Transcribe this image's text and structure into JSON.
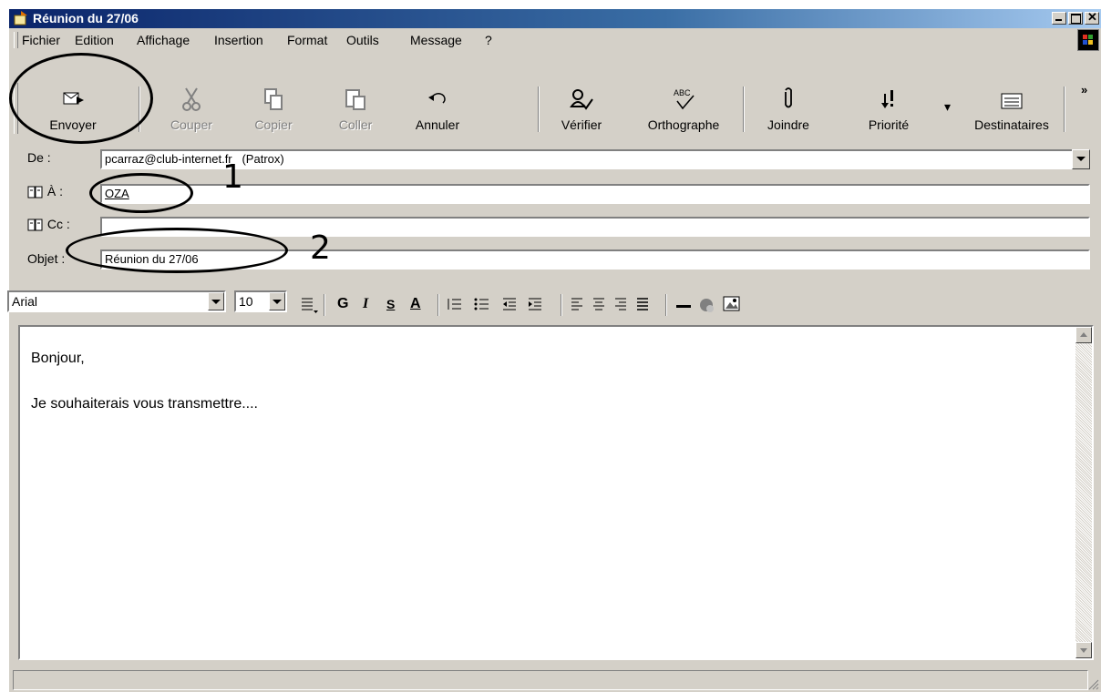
{
  "window": {
    "title": "Réunion du 27/06"
  },
  "menu": {
    "items": [
      "Fichier",
      "Edition",
      "Affichage",
      "Insertion",
      "Format",
      "Outils",
      "Message",
      "?"
    ]
  },
  "toolbar": {
    "buttons": [
      {
        "label": "Envoyer",
        "icon": "send-icon",
        "enabled": true
      },
      {
        "label": "Couper",
        "icon": "scissors-icon",
        "enabled": false
      },
      {
        "label": "Copier",
        "icon": "copy-icon",
        "enabled": false
      },
      {
        "label": "Coller",
        "icon": "paste-icon",
        "enabled": false
      },
      {
        "label": "Annuler",
        "icon": "undo-icon",
        "enabled": true
      },
      {
        "label": "Vérifier",
        "icon": "check-names-icon",
        "enabled": true
      },
      {
        "label": "Orthographe",
        "icon": "spelling-icon",
        "enabled": true
      },
      {
        "label": "Joindre",
        "icon": "paperclip-icon",
        "enabled": true
      },
      {
        "label": "Priorité",
        "icon": "priority-icon",
        "enabled": true
      },
      {
        "label": "Destinataires",
        "icon": "address-book-icon",
        "enabled": true
      }
    ],
    "overflow": "»"
  },
  "header": {
    "from_label": "De :",
    "from_value": "pcarraz@club-internet.fr   (Patrox)",
    "to_label": "À :",
    "to_value": "OZA",
    "cc_label": "Cc :",
    "cc_value": "",
    "subject_label": "Objet :",
    "subject_value": "Réunion du 27/06"
  },
  "format": {
    "font": "Arial",
    "size": "10"
  },
  "body": {
    "line1": "Bonjour,",
    "line2": "Je souhaiterais vous transmettre...."
  },
  "annotations": {
    "one": "1",
    "two": "2"
  }
}
